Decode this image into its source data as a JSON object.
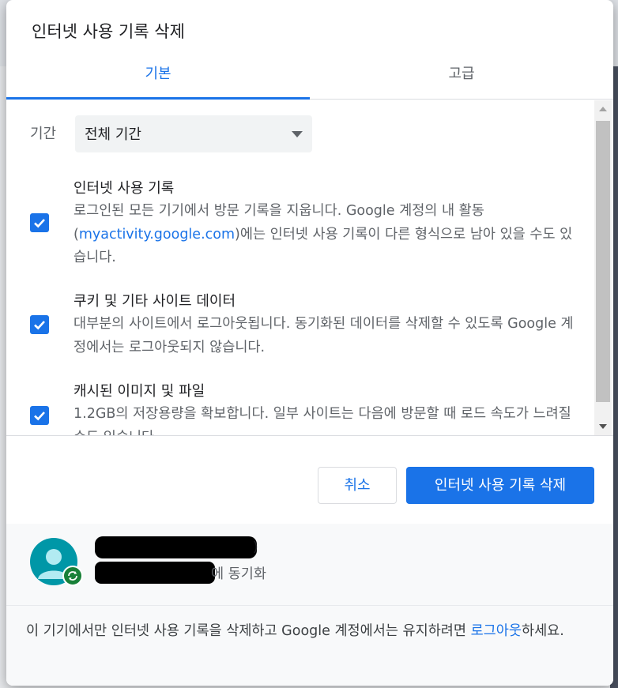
{
  "dialog": {
    "title": "인터넷 사용 기록 삭제"
  },
  "tabs": [
    {
      "label": "기본",
      "selected": true
    },
    {
      "label": "고급",
      "selected": false
    }
  ],
  "time_range": {
    "label": "기간",
    "selected": "전체 기간"
  },
  "items": [
    {
      "title": "인터넷 사용 기록",
      "desc_before": "로그인된 모든 기기에서 방문 기록을 지웁니다. Google 계정의 내 활동 (",
      "desc_link": "myactivity.google.com",
      "desc_after": ")에는 인터넷 사용 기록이 다른 형식으로 남아 있을 수도 있습니다.",
      "checked": true
    },
    {
      "title": "쿠키 및 기타 사이트 데이터",
      "desc": "대부분의 사이트에서 로그아웃됩니다. 동기화된 데이터를 삭제할 수 있도록 Google 계정에서는 로그아웃되지 않습니다.",
      "checked": true
    },
    {
      "title": "캐시된 이미지 및 파일",
      "desc": "1.2GB의 저장용량을 확보합니다. 일부 사이트는 다음에 방문할 때 로드 속도가 느려질 수도 있습니다.",
      "checked": true
    }
  ],
  "buttons": {
    "cancel": "취소",
    "delete": "인터넷 사용 기록 삭제"
  },
  "account": {
    "paren": ")",
    "sync_suffix": "에 동기화"
  },
  "footer_note": {
    "before": "이 기기에서만 인터넷 사용 기록을 삭제하고 Google 계정에서는 유지하려면 ",
    "link": "로그아웃",
    "after": "하세요."
  },
  "colors": {
    "accent": "#1a73e8",
    "sync_badge": "#188038",
    "avatar": "#0097a7"
  },
  "icons": {
    "checkbox": "checkmark-icon",
    "dropdown": "chevron-down-icon",
    "avatar": "person-icon",
    "sync": "sync-icon"
  }
}
